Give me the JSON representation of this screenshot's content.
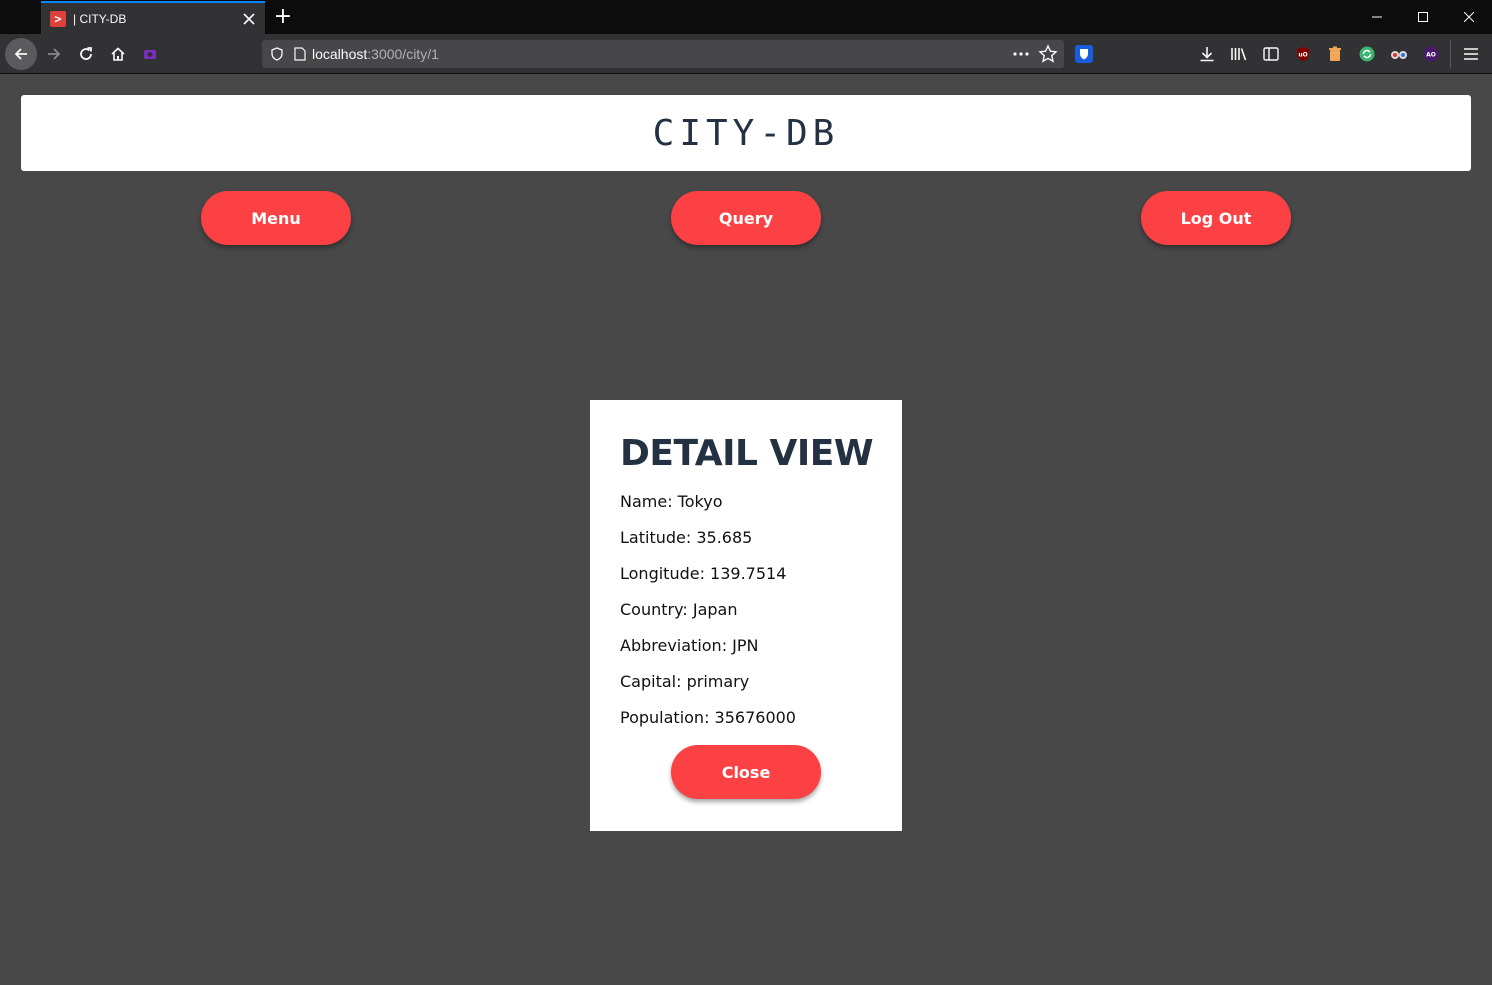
{
  "browser": {
    "tab_title": "| CITY-DB",
    "tab_favicon_glyph": ">",
    "url_host": "localhost",
    "url_path": ":3000/city/1",
    "new_tab_glyph": "+",
    "accent_color": "#0a84ff"
  },
  "site": {
    "title": "CITY-DB"
  },
  "nav": {
    "menu_label": "Menu",
    "query_label": "Query",
    "logout_label": "Log Out",
    "button_color": "#fc4145"
  },
  "detail": {
    "heading": "DETAIL VIEW",
    "rows": [
      "Name: Tokyo",
      "Latitude: 35.685",
      "Longitude: 139.7514",
      "Country: Japan",
      "Abbreviation: JPN",
      "Capital: primary",
      "Population: 35676000"
    ],
    "close_label": "Close"
  }
}
